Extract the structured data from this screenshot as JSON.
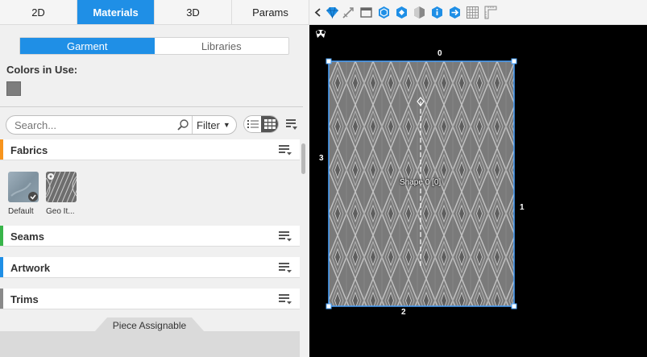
{
  "tabs": [
    {
      "label": "2D"
    },
    {
      "label": "Materials"
    },
    {
      "label": "3D"
    },
    {
      "label": "Params"
    }
  ],
  "subtabs": [
    {
      "label": "Garment"
    },
    {
      "label": "Libraries"
    }
  ],
  "colors_title": "Colors in Use:",
  "colors_in_use": [
    "#7d7d7d"
  ],
  "search": {
    "placeholder": "Search..."
  },
  "filter_label": "Filter",
  "sections": {
    "fabrics": {
      "title": "Fabrics",
      "color": "#f7941d"
    },
    "seams": {
      "title": "Seams",
      "color": "#39b54a"
    },
    "artwork": {
      "title": "Artwork",
      "color": "#1f8fe6"
    },
    "trims": {
      "title": "Trims",
      "color": "#8a8a8a"
    }
  },
  "fabrics": [
    {
      "label": "Default"
    },
    {
      "label": "Geo It..."
    }
  ],
  "piece_assignable": "Piece Assignable",
  "viewport": {
    "shape_label": "Shape 0 [0]",
    "edge_labels": {
      "top": "0",
      "right": "1",
      "bottom": "2",
      "left": "3"
    }
  },
  "accent_color": "#1f8fe6"
}
